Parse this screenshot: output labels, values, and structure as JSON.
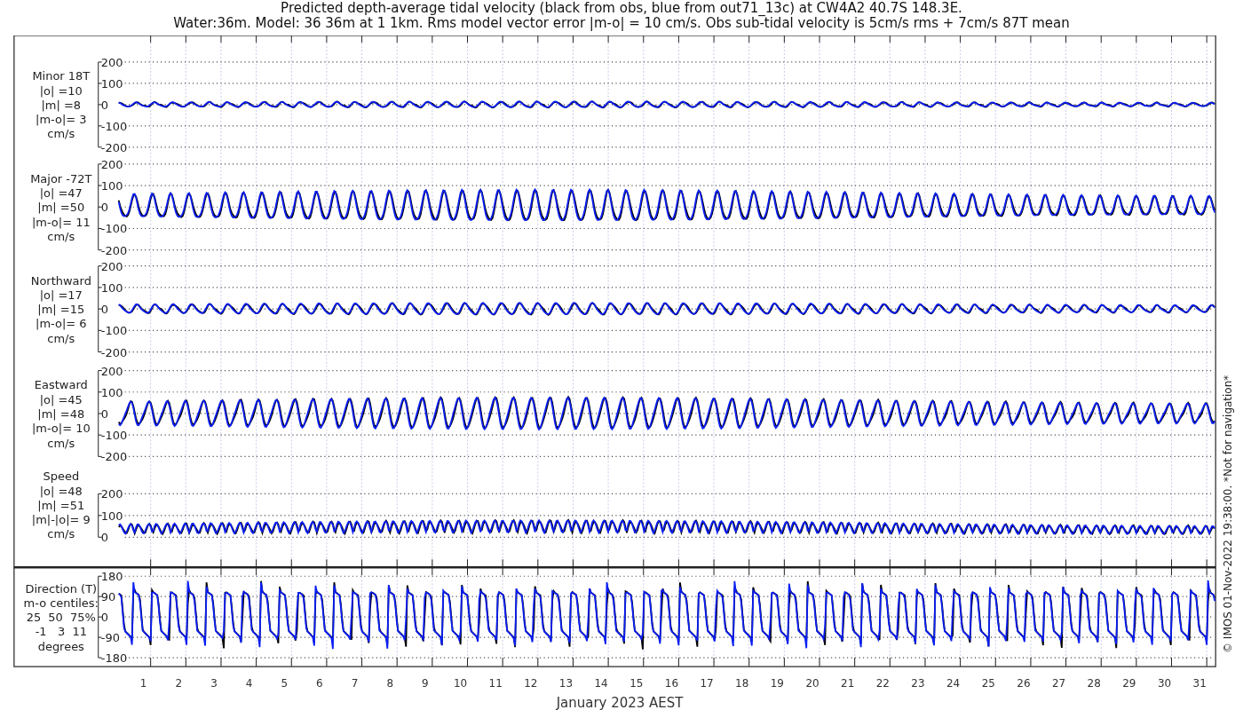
{
  "title": [
    "Predicted depth-average tidal velocity (black from obs, blue from out71_13c) at CW4A2 40.7S 148.3E.",
    "Water:36m. Model: 36 36m at 1 1km. Rms model vector error |m-o| = 10 cm/s. Obs sub-tidal velocity is 5cm/s rms + 7cm/s 87T mean"
  ],
  "panels": [
    {
      "kind": "component",
      "label": [
        "Minor 18T",
        "|o| =10",
        "|m| =8",
        "|m-o|= 3",
        "cm/s"
      ],
      "yticks": [
        "200",
        "100",
        "0",
        "-100",
        "-200"
      ]
    },
    {
      "kind": "component",
      "label": [
        "Major -72T",
        "|o| =47",
        "|m| =50",
        "|m-o|= 11",
        "cm/s"
      ],
      "yticks": [
        "200",
        "100",
        "0",
        "-100",
        "-200"
      ]
    },
    {
      "kind": "component",
      "label": [
        "Northward",
        "|o| =17",
        "|m| =15",
        "|m-o|= 6",
        "cm/s"
      ],
      "yticks": [
        "200",
        "100",
        "0",
        "-100",
        "-200"
      ]
    },
    {
      "kind": "component",
      "label": [
        "Eastward",
        "|o| =45",
        "|m| =48",
        "|m-o|= 10",
        "cm/s"
      ],
      "yticks": [
        "200",
        "100",
        "0",
        "-100",
        "-200"
      ]
    },
    {
      "kind": "speed",
      "label": [
        "Speed",
        "|o| =48",
        "|m| =51",
        "|m|-|o|= 9",
        "cm/s"
      ],
      "yticks": [
        "200",
        "100",
        "0"
      ]
    },
    {
      "kind": "direction",
      "label": [
        "Direction (T)",
        "m-o centiles:",
        "25  50  75%",
        "-1   3  11",
        "degrees"
      ],
      "yticks": [
        "180",
        "90",
        "0",
        "-90",
        "-180"
      ]
    }
  ],
  "xticks": [
    "1",
    "2",
    "3",
    "4",
    "5",
    "6",
    "7",
    "8",
    "9",
    "10",
    "11",
    "12",
    "13",
    "14",
    "15",
    "16",
    "17",
    "18",
    "19",
    "20",
    "21",
    "22",
    "23",
    "24",
    "25",
    "26",
    "27",
    "28",
    "29",
    "30",
    "31"
  ],
  "xlabel": "January 2023 AEST",
  "credit": "© IMOS 01-Nov-2022 19:38:00. *Not for navigation*"
}
